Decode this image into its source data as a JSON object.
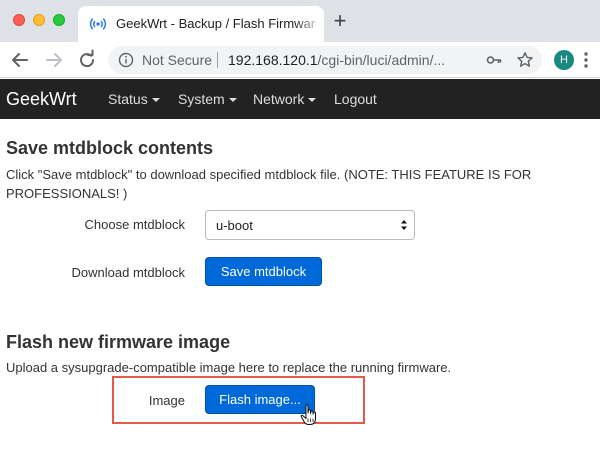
{
  "browser": {
    "tab_title": "GeekWrt - Backup / Flash Firmware",
    "security_label": "Not Secure",
    "url_host": "192.168.120.1",
    "url_path": "/cgi-bin/luci/admin/...",
    "avatar_letter": "H"
  },
  "navbar": {
    "brand": "GeekWrt",
    "items": [
      {
        "label": "Status",
        "has_menu": true
      },
      {
        "label": "System",
        "has_menu": true
      },
      {
        "label": "Network",
        "has_menu": true
      },
      {
        "label": "Logout",
        "has_menu": false
      }
    ]
  },
  "save_section": {
    "title": "Save mtdblock contents",
    "description": "Click \"Save mtdblock\" to download specified mtdblock file. (NOTE: THIS FEATURE IS FOR PROFESSIONALS! )",
    "choose_label": "Choose mtdblock",
    "selected_block": "u-boot",
    "download_label": "Download mtdblock",
    "save_button": "Save mtdblock"
  },
  "flash_section": {
    "title": "Flash new firmware image",
    "description": "Upload a sysupgrade-compatible image here to replace the running firmware.",
    "image_label": "Image",
    "flash_button": "Flash image..."
  },
  "colors": {
    "navbar_bg": "#222222",
    "primary_button": "#0069d9",
    "highlight_border": "#e25a4a"
  }
}
